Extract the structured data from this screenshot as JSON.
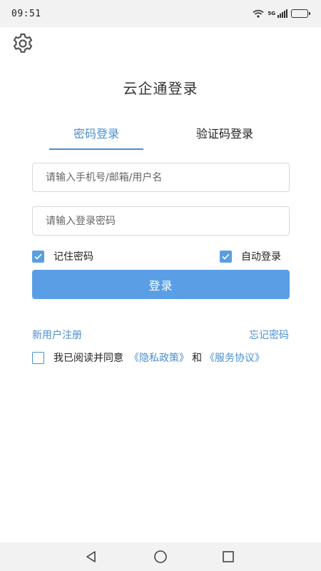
{
  "status_bar": {
    "time": "09:51",
    "network": "5G",
    "icons": [
      "wifi-icon",
      "signal-icon",
      "battery-icon"
    ]
  },
  "header": {
    "settings_icon": "gear-icon",
    "title": "云企通登录"
  },
  "tabs": [
    {
      "label": "密码登录",
      "active": true
    },
    {
      "label": "验证码登录",
      "active": false
    }
  ],
  "form": {
    "username_placeholder": "请输入手机号/邮箱/用户名",
    "username_value": "",
    "password_placeholder": "请输入登录密码",
    "password_value": "",
    "remember_label": "记住密码",
    "remember_checked": true,
    "auto_login_label": "自动登录",
    "auto_login_checked": true,
    "login_button": "登录"
  },
  "links": {
    "register": "新用户注册",
    "forgot": "忘记密码"
  },
  "agreement": {
    "checked": false,
    "text": "我已阅读并同意",
    "privacy": "《隐私政策》",
    "and": "和",
    "service": "《服务协议》"
  },
  "nav_bar": {
    "icons": [
      "back-icon",
      "home-icon",
      "recent-apps-icon"
    ]
  },
  "colors": {
    "accent": "#4a8fd0",
    "button": "#5a9ee6",
    "checkbox": "#5b9ee0"
  }
}
